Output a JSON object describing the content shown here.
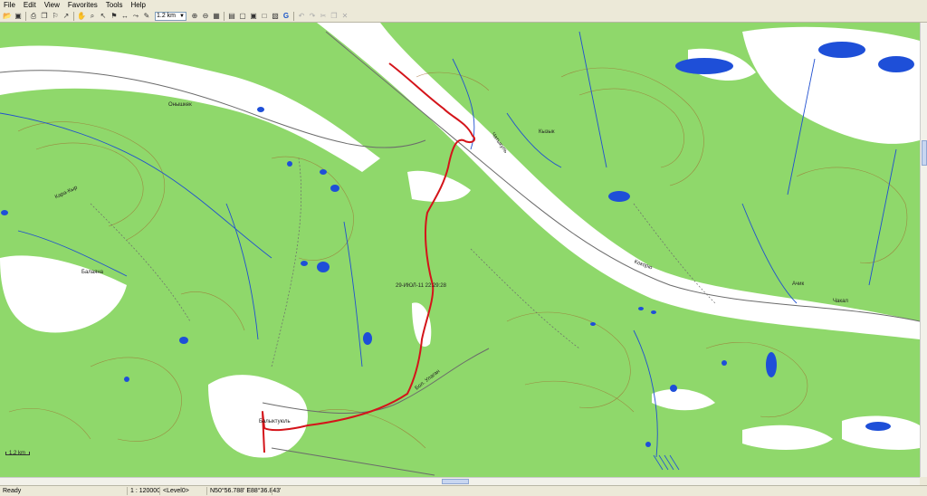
{
  "menu": [
    "File",
    "Edit",
    "View",
    "Favorites",
    "Tools",
    "Help"
  ],
  "toolbar": {
    "scale_value": "1.2 km",
    "icons": [
      "open-folder-icon",
      "save-icon",
      "print-icon",
      "copy-icon",
      "find-icon",
      "route-icon",
      "hand-icon",
      "zoom-icon",
      "select-icon",
      "waypoint-icon",
      "measure-icon",
      "track-icon",
      "draw-icon",
      "scale-select",
      "zoom-in-icon",
      "zoom-out-icon",
      "mapsource-icon",
      "3d-view-icon",
      "screen-icon",
      "gps-icon",
      "doc-icon",
      "map-icon",
      "google-earth-icon",
      "undo-icon",
      "redo-icon",
      "cut-icon",
      "paste-icon",
      "delete-icon"
    ]
  },
  "map": {
    "track_label": "29-ИЮЛ-11 22:29:28",
    "scale_bar_label": "1.2 km",
    "village_labels": [
      "Балыктуюль",
      "Балаяна"
    ],
    "river_labels": [
      "Бол. Улаган",
      "Онышкек",
      "Балыктуюль",
      "Чатыкуль",
      "Кызык",
      "Кокорю",
      "Ачик",
      "Чакал",
      "Кара-Кыр",
      "Тюнгур"
    ],
    "colors": {
      "forest": "#8fd86b",
      "open": "#ffffff",
      "water": "#1e4fd8",
      "track": "#d4141a",
      "contour": "#a0622a",
      "road": "#6b6b6b"
    }
  },
  "status": {
    "ready": "Ready",
    "scale": "1 : 120000",
    "level": "<Level0>",
    "coords": "N50°56.788' E88°36.843'"
  }
}
